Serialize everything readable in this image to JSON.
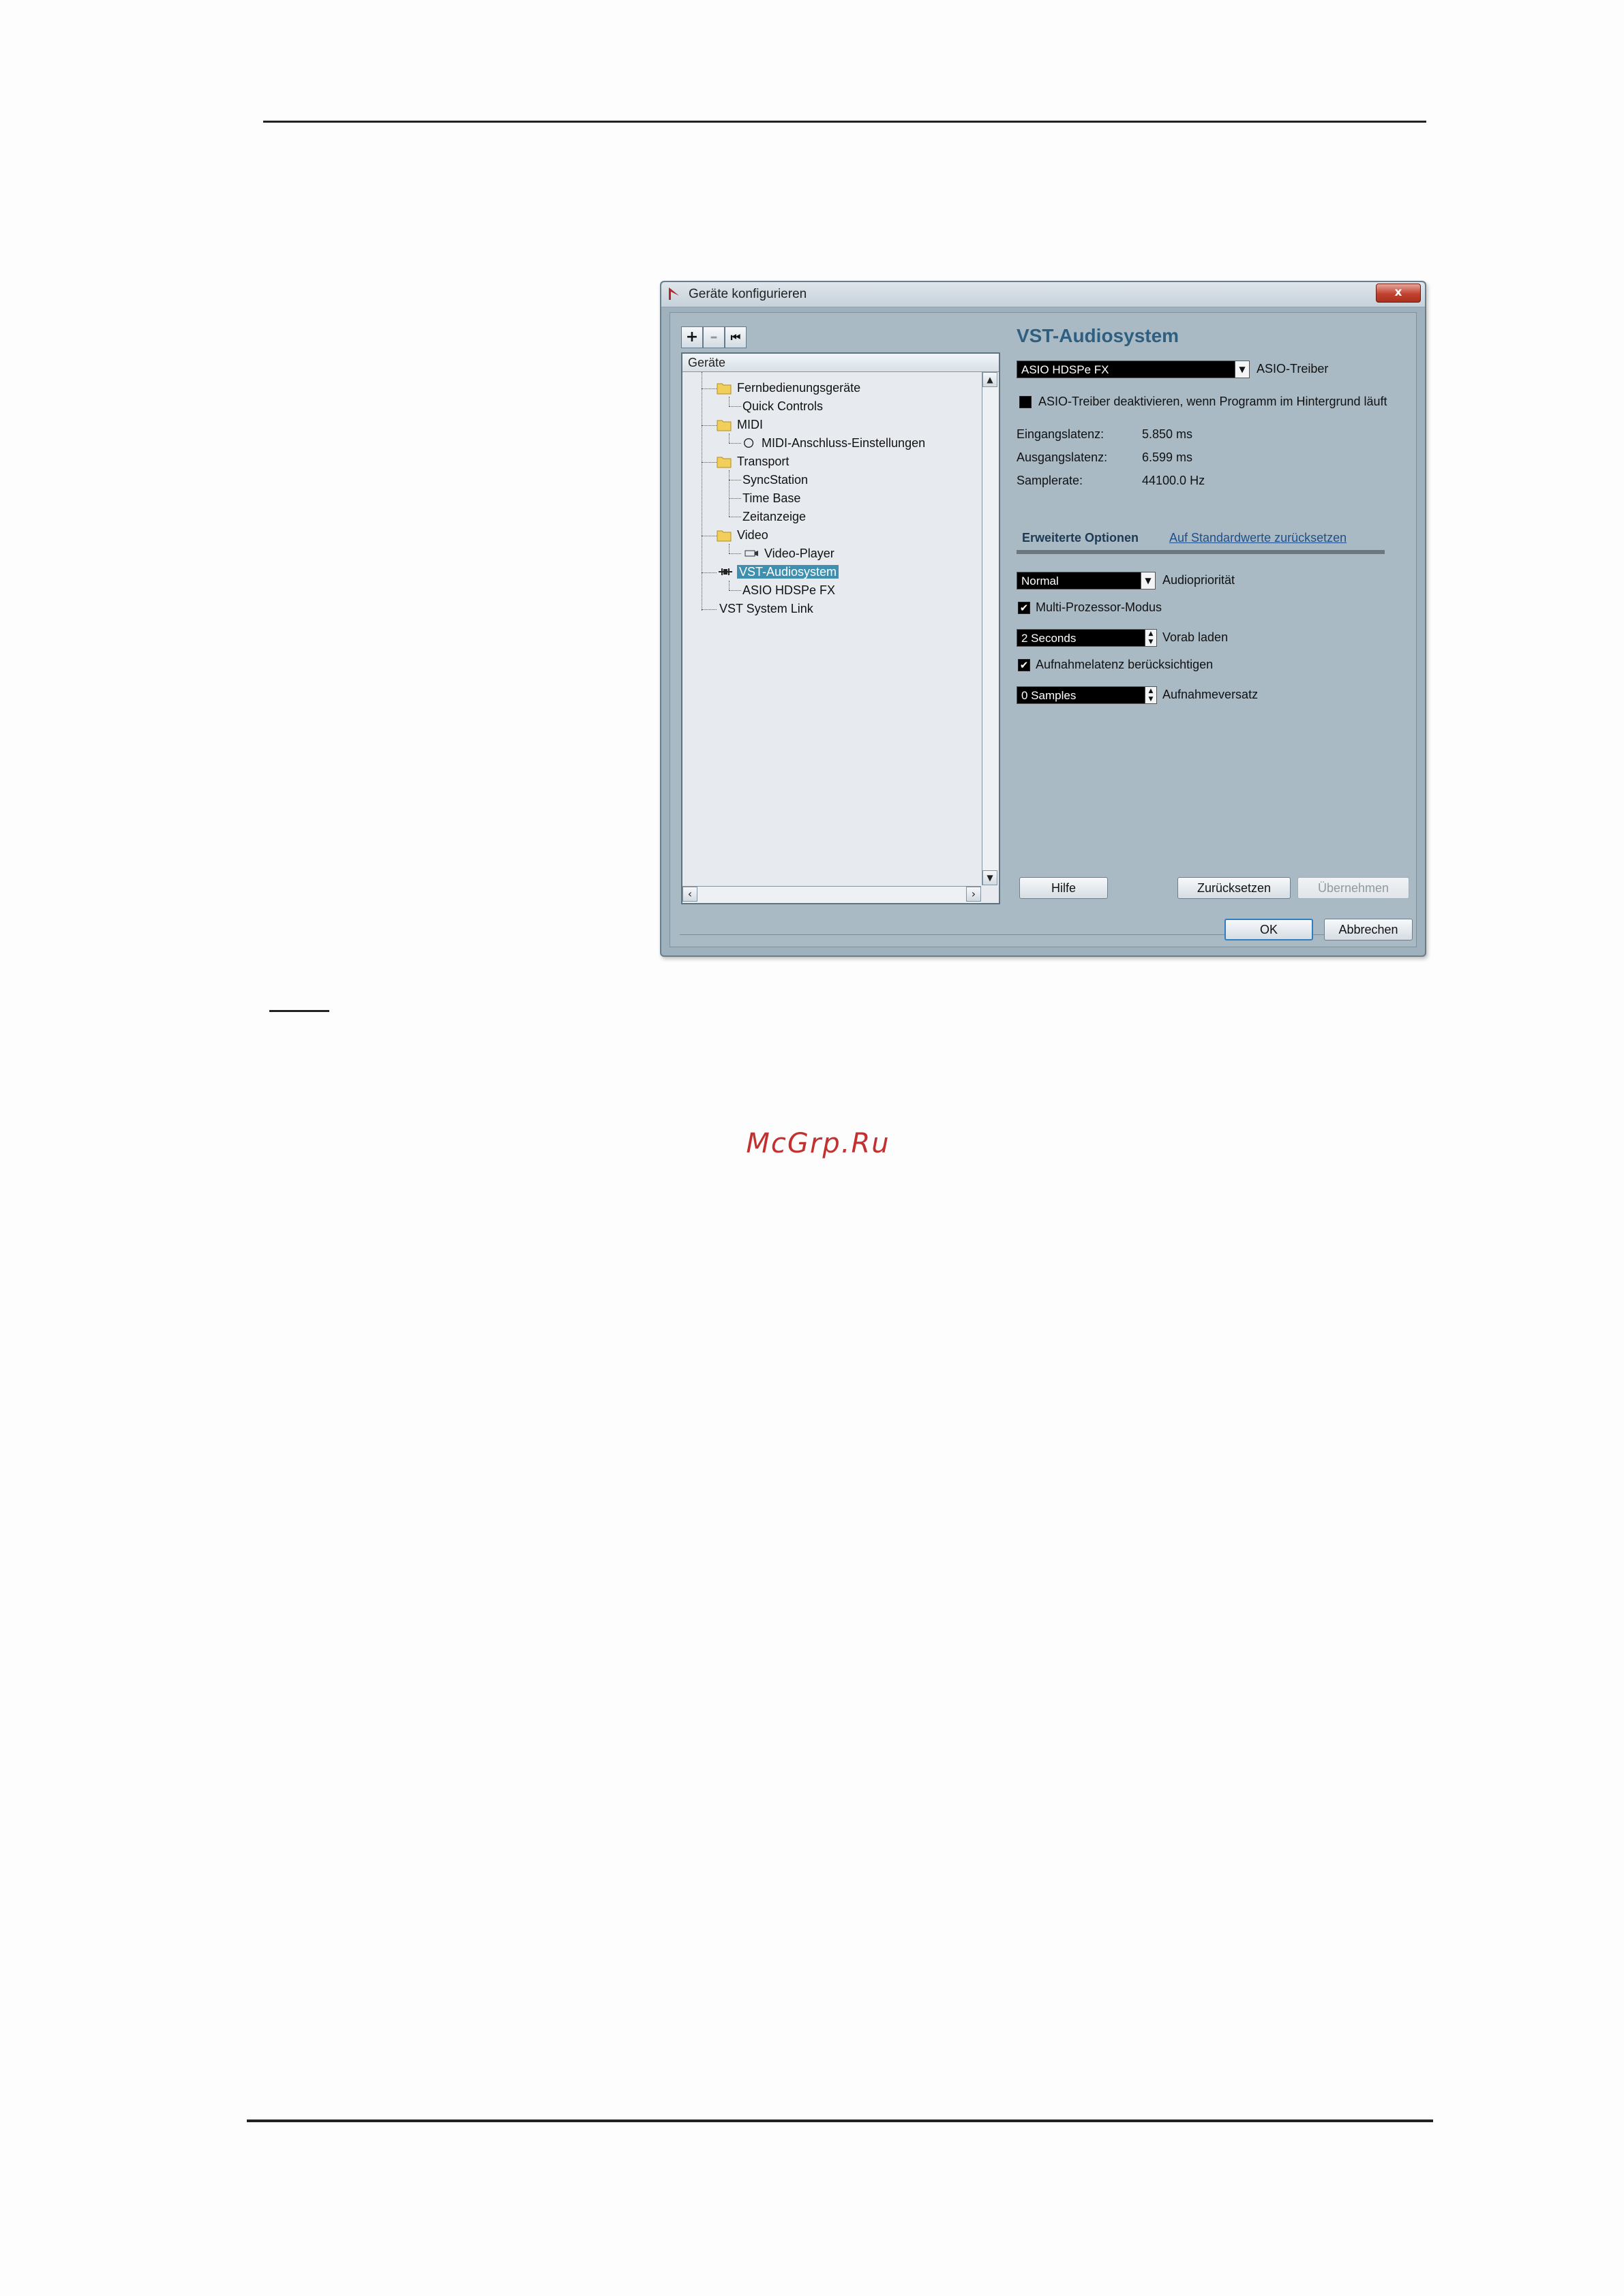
{
  "dialog": {
    "title": "Geräte konfigurieren",
    "close_glyph": "x",
    "toolbar": {
      "add": "+",
      "remove": "–",
      "reset": "⏮"
    },
    "tree": {
      "header": "Geräte",
      "items": [
        {
          "label": "Fernbedienungsgeräte"
        },
        {
          "label": "Quick Controls"
        },
        {
          "label": "MIDI"
        },
        {
          "label": "MIDI-Anschluss-Einstellungen"
        },
        {
          "label": "Transport"
        },
        {
          "label": "SyncStation"
        },
        {
          "label": "Time Base"
        },
        {
          "label": "Zeitanzeige"
        },
        {
          "label": "Video"
        },
        {
          "label": "Video-Player"
        },
        {
          "label": "VST-Audiosystem",
          "selected": true
        },
        {
          "label": "ASIO HDSPe FX"
        },
        {
          "label": "VST System Link"
        }
      ]
    },
    "panel": {
      "title": "VST-Audiosystem",
      "driver_value": "ASIO HDSPe FX",
      "driver_label": "ASIO-Treiber",
      "deactivate_label": "ASIO-Treiber deaktivieren, wenn Programm im Hintergrund läuft",
      "input_latency_label": "Eingangslatenz:",
      "input_latency_value": "5.850 ms",
      "output_latency_label": "Ausgangslatenz:",
      "output_latency_value": "6.599 ms",
      "samplerate_label": "Samplerate:",
      "samplerate_value": "44100.0 Hz",
      "tab_advanced": "Erweiterte Optionen",
      "link_defaults": "Auf Standardwerte zurücksetzen",
      "priority_value": "Normal",
      "priority_label": "Audiopriorität",
      "multiproc_label": "Multi-Prozessor-Modus",
      "multiproc_checked": true,
      "preload_value": "2 Seconds",
      "preload_label": "Vorab laden",
      "latency_comp_label": "Aufnahmelatenz berücksichtigen",
      "latency_comp_checked": true,
      "offset_value": "0 Samples",
      "offset_label": "Aufnahmeversatz",
      "check_glyph": "✔",
      "dropdown_glyph": "▼",
      "spin_up": "▲",
      "spin_down": "▼"
    },
    "buttons": {
      "help": "Hilfe",
      "reset": "Zurücksetzen",
      "apply": "Übernehmen",
      "ok": "OK",
      "cancel": "Abbrechen"
    }
  },
  "watermark": "McGrp.Ru",
  "colors": {
    "accent_title": "#2e5f80",
    "selection": "#3f8fb0",
    "close": "#c2412f",
    "watermark": "#c23030"
  }
}
